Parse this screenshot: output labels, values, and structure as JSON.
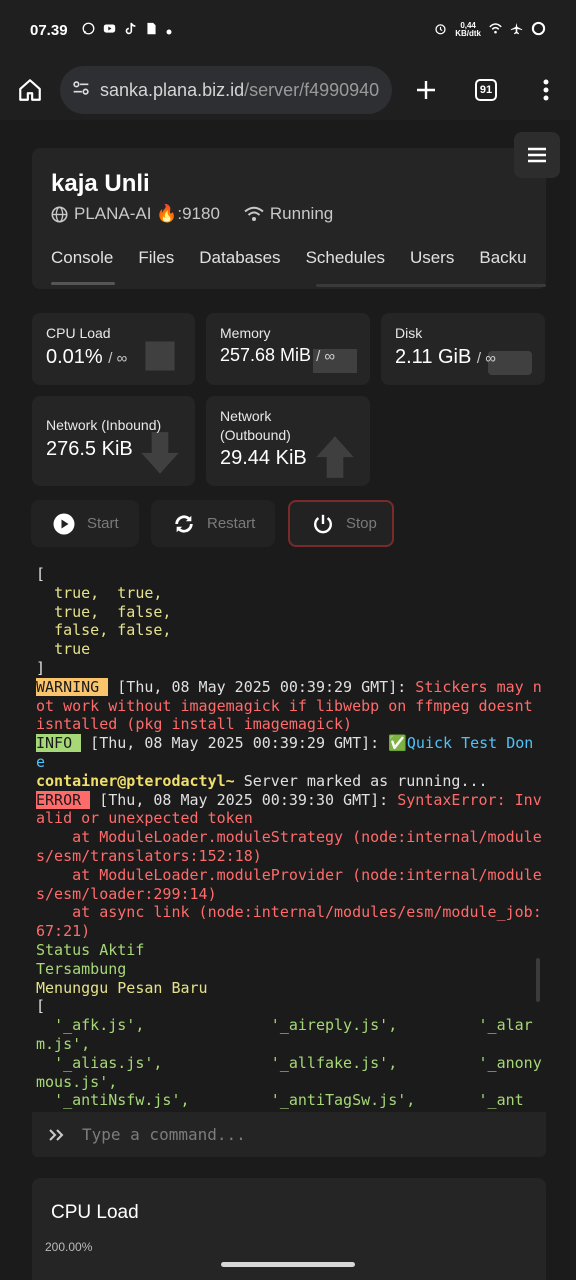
{
  "status_bar": {
    "time": "07.39",
    "speed_top": "0,44",
    "speed_bottom": "KB/dtk"
  },
  "browser": {
    "url_host": "sanka.plana.biz.id",
    "url_path": "/server/f4990940",
    "tab_count": "91"
  },
  "server": {
    "name": "kaja Unli",
    "node": "PLANA-AI 🔥:9180",
    "status": "Running",
    "tabs": [
      "Console",
      "Files",
      "Databases",
      "Schedules",
      "Users",
      "Backu"
    ]
  },
  "stats": {
    "cpu": {
      "label": "CPU Load",
      "value": "0.01%",
      "limit": "/ ∞"
    },
    "memory": {
      "label": "Memory",
      "value": "257.68 MiB",
      "limit": "/ ∞"
    },
    "disk": {
      "label": "Disk",
      "value": "2.11 GiB",
      "limit": "/ ∞"
    },
    "net_in": {
      "label": "Network (Inbound)",
      "value": "276.5 KiB"
    },
    "net_out": {
      "label_1": "Network",
      "label_2": "(Outbound)",
      "value": "29.44 KiB"
    }
  },
  "power": {
    "start": "Start",
    "restart": "Restart",
    "stop": "Stop"
  },
  "console": {
    "lines": {
      "l1": "[",
      "l2": "  true,  true,",
      "l3": "  true,  false,",
      "l4": "  false, false,",
      "l5": "  true",
      "l6": "]",
      "warn_badge": "WARNING ",
      "warn_time": " [Thu, 08 May 2025 00:39:29 GMT]: ",
      "warn_msg": "Stickers may not work without imagemagick if libwebp on ffmpeg doesnt isntalled (pkg install imagemagick)",
      "info_badge": "INFO ",
      "info_time": " [Thu, 08 May 2025 00:39:29 GMT]: ",
      "info_msg": "✅Quick Test Done",
      "prompt": "container@pterodactyl~",
      "prompt_msg": " Server marked as running...",
      "err_badge": "ERROR ",
      "err_time": " [Thu, 08 May 2025 00:39:30 GMT]: ",
      "err_msg": "SyntaxError: Invalid or unexpected token",
      "trace1": "    at ModuleLoader.moduleStrategy (node:internal/modules/esm/translators:152:18)",
      "trace2": "    at ModuleLoader.moduleProvider (node:internal/modules/esm/loader:299:14)",
      "trace3": "    at async link (node:internal/modules/esm/module_job:67:21)",
      "s1": "Status Aktif",
      "s2": "Tersambung",
      "s3": "Menunggu Pesan Baru",
      "b1": "[",
      "f1": "  '_afk.js',              '_aireply.js',         '_alarm.js',",
      "f2": "  '_alias.js',            '_allfake.js',         '_anonymous.js',",
      "f3": "  '_antiNsfw.js',         '_antiTagSw.js',       '_ant"
    },
    "placeholder": "Type a command..."
  },
  "cpu_chart": {
    "title": "CPU Load",
    "axis_top": "200.00%"
  }
}
